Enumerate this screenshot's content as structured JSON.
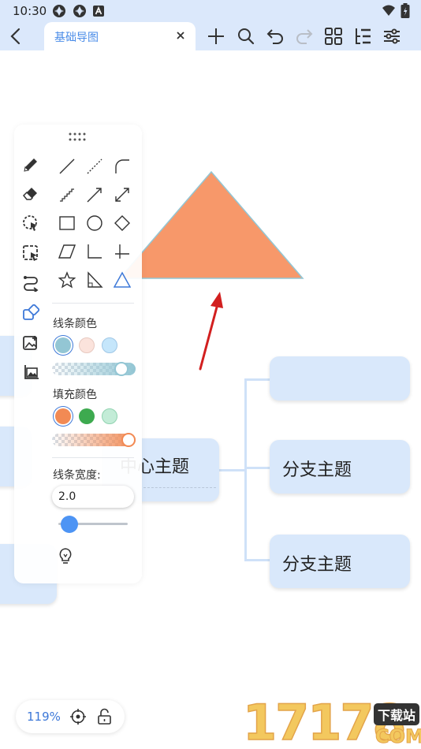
{
  "status_bar": {
    "time": "10:30"
  },
  "toolbar": {
    "tab_title": "基础导图",
    "icons": [
      "back-icon",
      "plus-icon",
      "search-icon",
      "undo-icon",
      "redo-icon",
      "grid-icon",
      "outline-icon",
      "settings-icon"
    ]
  },
  "mindmap": {
    "center_topic": "中心主题",
    "branch_1": "",
    "branch_2": "分支主题",
    "branch_3": "分支主题"
  },
  "panel": {
    "line_color_label": "线条颜色",
    "fill_color_label": "填充颜色",
    "line_width_label": "线条宽度:",
    "line_width_value": "2.0",
    "line_colors": [
      "#93c6d4",
      "#fbe3dc",
      "#c5e6fb"
    ],
    "fill_colors": [
      "#f28a54",
      "#3daa4f",
      "#c3ecd7"
    ],
    "line_opacity": 0.9,
    "fill_opacity": 1.0,
    "line_width_slider": 0.05
  },
  "shape": {
    "type": "triangle",
    "fill": "#f7986a",
    "stroke": "#93c6d4"
  },
  "bottom_bar": {
    "zoom": "119%"
  },
  "watermark": {
    "number": "17178",
    "site_label": "下载站",
    "domain": "COM"
  },
  "colors": {
    "accent": "#3d78d8",
    "toolbar_bg": "#dbe8fb",
    "node_bg": "#d9e8fb"
  }
}
